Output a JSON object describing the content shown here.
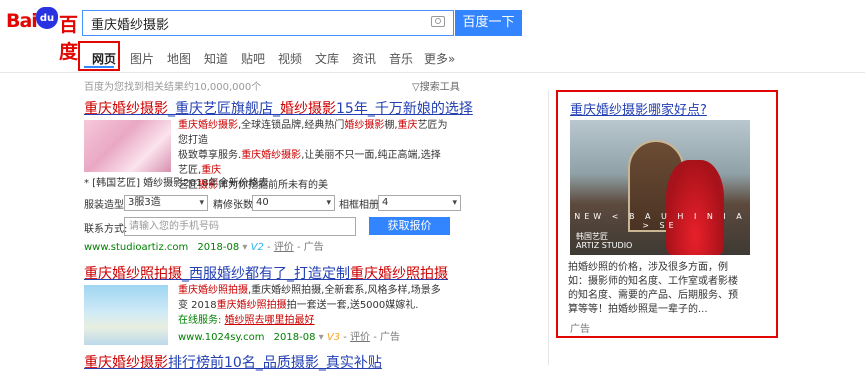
{
  "logo": {
    "bai": "Bai",
    "paw": "du",
    "du": "百度"
  },
  "search": {
    "value": "重庆婚纱摄影",
    "button": "百度一下"
  },
  "tabs": [
    "网页",
    "图片",
    "地图",
    "知道",
    "贴吧",
    "视频",
    "文库",
    "资讯",
    "音乐",
    "更多»"
  ],
  "result_count": "百度为您找到相关结果约10,000,000个",
  "search_tools": "搜索工具",
  "r1": {
    "title": [
      "重庆婚纱摄影",
      "_重庆艺匠旗舰店_",
      "婚纱摄影",
      "15年_千万新娘的选择"
    ],
    "desc_l1": [
      "重庆婚纱摄影",
      ",全球连锁品牌,经典热门",
      "婚纱摄影",
      "棚,",
      "重庆",
      "艺匠为您打造"
    ],
    "desc_l2": [
      "极致尊享服务.",
      "重庆婚纱摄影",
      ",让美丽不只一面,纯正高端,选择艺匠,",
      "重庆"
    ],
    "desc_l3": [
      "艺匠",
      "摄影",
      "师为你挖掘前所未有的美"
    ],
    "sub_line": "* [韩国艺匠] 婚纱摄影2018年全新价格表",
    "form": {
      "f1_label": "服装造型:",
      "f1_value": "3服3造",
      "f2_label": "精修张数:",
      "f2_value": "40",
      "f3_label": "相框相册:",
      "f3_value": "4",
      "phone_label": "联系方式:",
      "phone_placeholder": "请输入您的手机号码",
      "button": "获取报价"
    },
    "url": "www.studioartiz.com",
    "date": "2018-08",
    "v_badge": "V2",
    "rate": "评价",
    "ad": "广告"
  },
  "r2": {
    "title": [
      "重庆婚纱照拍摄",
      "_西服婚纱都有了_打造定制",
      "重庆婚纱照拍摄"
    ],
    "desc_l1": [
      "重庆婚纱照拍摄",
      ",重庆婚纱照拍摄,全新套系,风格多样,场景多"
    ],
    "desc_l2": [
      "变 2018",
      "重庆婚纱照拍摄",
      "拍一套送一套,送5000媒嫁礼."
    ],
    "service_label": "在线服务:",
    "service_link": "婚纱照去哪里拍最好",
    "url": "www.1024sy.com",
    "date": "2018-08",
    "v_badge": "V3",
    "rate": "评价",
    "ad": "广告"
  },
  "r3": {
    "title": [
      "重庆婚纱摄影",
      "排行榜前10名_品质摄影_真实补贴"
    ]
  },
  "sidebar": {
    "title": "重庆婚纱摄影哪家好点?",
    "img_line": "NEW < B A U H I N I A > SE",
    "img_brand": "韩国艺匠\nARTIZ STUDIO",
    "desc": "拍婚纱照的价格，涉及很多方面，例如：摄影师的知名度、工作室或者影楼的知名度、需要的产品、后期服务、预算等等！拍婚纱照是一辈子的...",
    "ad": "广告"
  }
}
